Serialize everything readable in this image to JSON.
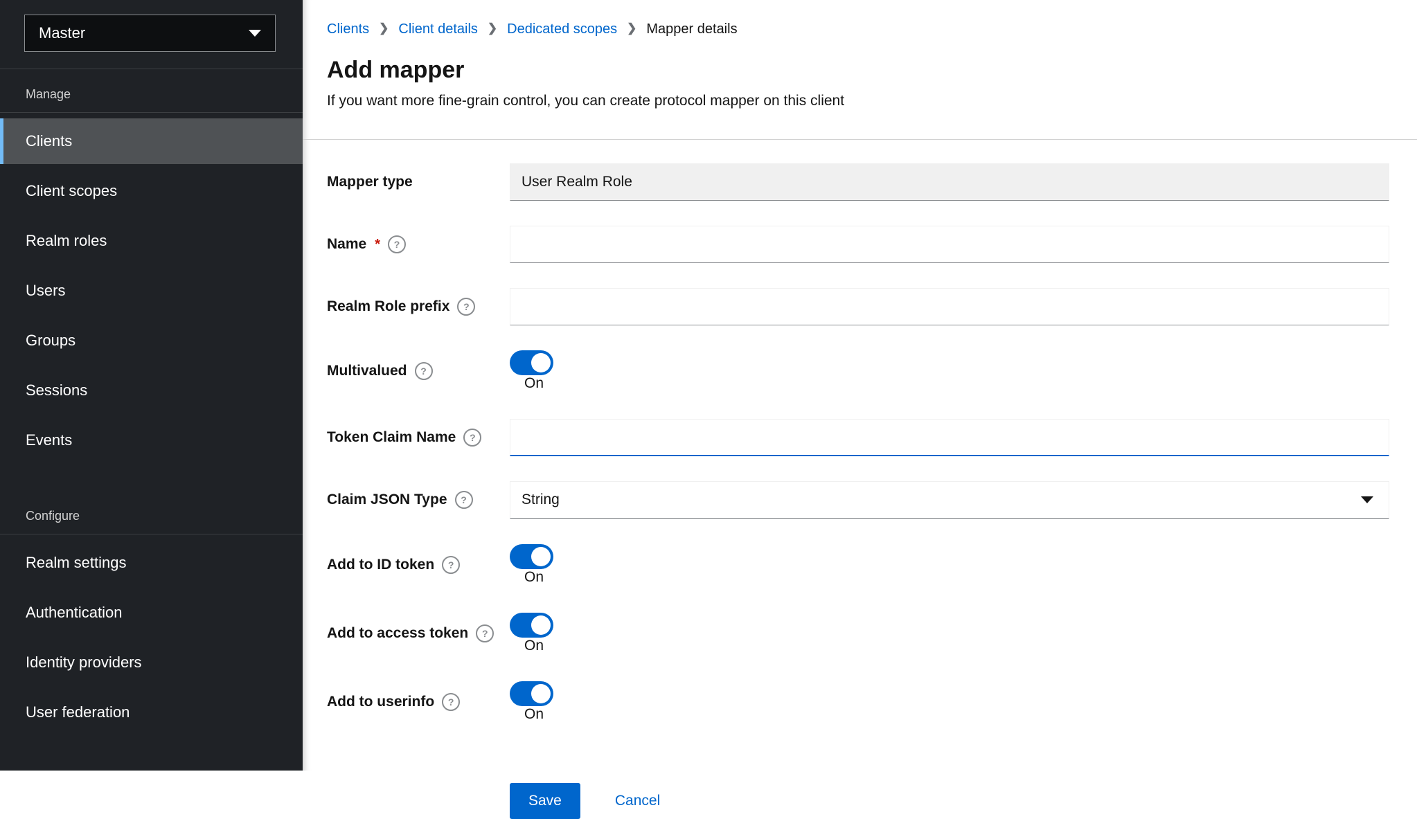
{
  "sidebar": {
    "realm_selector": {
      "label": "Master",
      "icon": "chevron-down-icon"
    },
    "groups": [
      {
        "label": "Manage",
        "items": [
          {
            "label": "Clients",
            "selected": true
          },
          {
            "label": "Client scopes",
            "selected": false
          },
          {
            "label": "Realm roles",
            "selected": false
          },
          {
            "label": "Users",
            "selected": false
          },
          {
            "label": "Groups",
            "selected": false
          },
          {
            "label": "Sessions",
            "selected": false
          },
          {
            "label": "Events",
            "selected": false
          }
        ]
      },
      {
        "label": "Configure",
        "items": [
          {
            "label": "Realm settings",
            "selected": false
          },
          {
            "label": "Authentication",
            "selected": false
          },
          {
            "label": "Identity providers",
            "selected": false
          },
          {
            "label": "User federation",
            "selected": false
          }
        ]
      }
    ]
  },
  "breadcrumb": {
    "separator": "❯",
    "items": [
      {
        "label": "Clients",
        "is_link": true
      },
      {
        "label": "Client details",
        "is_link": true
      },
      {
        "label": "Dedicated scopes",
        "is_link": true
      },
      {
        "label": "Mapper details",
        "is_link": false
      }
    ]
  },
  "page_header": {
    "title": "Add mapper",
    "subtitle": "If you want more fine-grain control, you can create protocol mapper on this client"
  },
  "form": {
    "required_indicator": "*",
    "help_icon_glyph": "?",
    "fields": [
      {
        "label": "Mapper type",
        "type": "readonly_text",
        "value": "User Realm Role",
        "required": false,
        "help": false
      },
      {
        "label": "Name",
        "type": "text",
        "value": "",
        "placeholder": "",
        "required": true,
        "help": true,
        "focused": false
      },
      {
        "label": "Realm Role prefix",
        "type": "text",
        "value": "",
        "placeholder": "",
        "required": false,
        "help": true,
        "focused": false
      },
      {
        "label": "Multivalued",
        "type": "toggle",
        "on": true,
        "state_label": "On",
        "required": false,
        "help": true
      },
      {
        "label": "Token Claim Name",
        "type": "text",
        "value": "",
        "placeholder": "",
        "required": false,
        "help": true,
        "focused": true
      },
      {
        "label": "Claim JSON Type",
        "type": "select",
        "value": "String",
        "required": false,
        "help": true
      },
      {
        "label": "Add to ID token",
        "type": "toggle",
        "on": true,
        "state_label": "On",
        "required": false,
        "help": true
      },
      {
        "label": "Add to access token",
        "type": "toggle",
        "on": true,
        "state_label": "On",
        "required": false,
        "help": true
      },
      {
        "label": "Add to userinfo",
        "type": "toggle",
        "on": true,
        "state_label": "On",
        "required": false,
        "help": true
      }
    ]
  },
  "actions": {
    "save_label": "Save",
    "cancel_label": "Cancel"
  },
  "colors": {
    "accent_blue": "#0066cc",
    "link_blue": "#0066cc",
    "sidebar_bg": "#1f2226",
    "nav_selected_bg": "#4f5255",
    "nav_selected_indicator": "#73bcf7",
    "required_red": "#c9190b",
    "divider_gray": "#d2d2d2",
    "disabled_input_bg": "#f0f0f0",
    "focus_underline": "#0066cc"
  }
}
